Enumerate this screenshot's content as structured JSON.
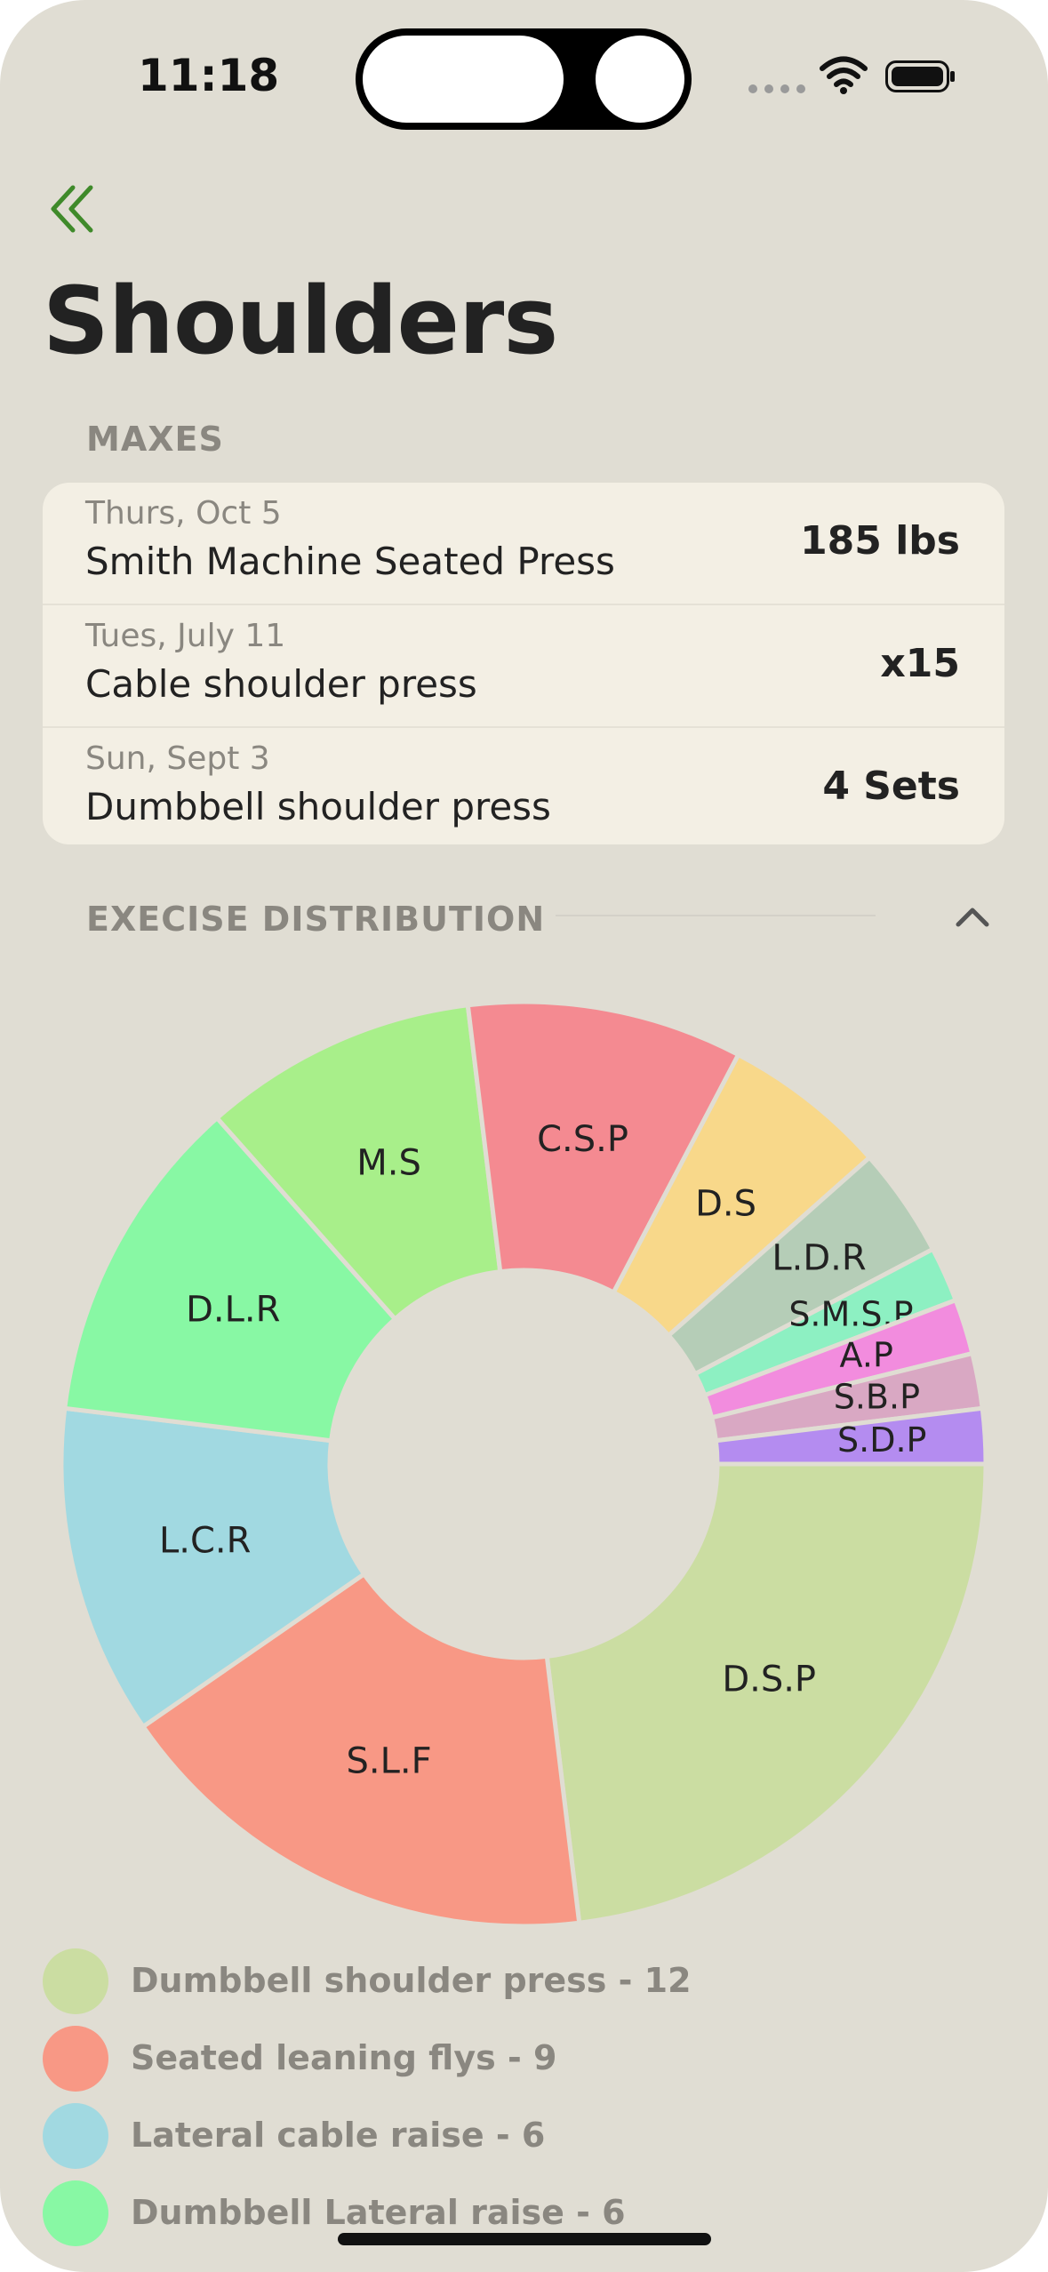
{
  "status_bar": {
    "time": "11:18"
  },
  "nav": {
    "back_icon": "double-chevron-left-icon",
    "accent": "#3f8a2a"
  },
  "page": {
    "title": "Shoulders"
  },
  "maxes": {
    "label": "MAXES",
    "rows": [
      {
        "date": "Thurs, Oct 5",
        "exercise": "Smith Machine Seated Press",
        "value": "185 lbs"
      },
      {
        "date": "Tues, July 11",
        "exercise": "Cable shoulder press",
        "value": "x15"
      },
      {
        "date": "Sun, Sept 3",
        "exercise": "Dumbbell shoulder press",
        "value": "4 Sets"
      }
    ]
  },
  "distribution": {
    "label": "EXECISE DISTRIBUTION",
    "collapse_icon": "chevron-up-icon",
    "legend": [
      {
        "text": "Dumbbell shoulder press - 12",
        "color": "#cbdda2"
      },
      {
        "text": "Seated leaning flys - 9",
        "color": "#f89885"
      },
      {
        "text": "Lateral cable raise - 6",
        "color": "#a1d9e1"
      },
      {
        "text": "Dumbbell Lateral raise - 6",
        "color": "#88f8a4"
      }
    ]
  },
  "chart_data": {
    "type": "pie",
    "title": "",
    "slices": [
      {
        "label": "D.S.P",
        "value": 12,
        "color": "#cbdda2"
      },
      {
        "label": "S.L.F",
        "value": 9,
        "color": "#f89885"
      },
      {
        "label": "L.C.R",
        "value": 6,
        "color": "#a1d9e1"
      },
      {
        "label": "D.L.R",
        "value": 6,
        "color": "#88f8a4"
      },
      {
        "label": "M.S",
        "value": 5,
        "color": "#a8ef8a"
      },
      {
        "label": "C.S.P",
        "value": 5,
        "color": "#f48a91"
      },
      {
        "label": "D.S",
        "value": 3,
        "color": "#f8d88a"
      },
      {
        "label": "L.D.R",
        "value": 2,
        "color": "#b5cdb7"
      },
      {
        "label": "S.M.S.P",
        "value": 1,
        "color": "#8df0c2"
      },
      {
        "label": "A.P",
        "value": 1,
        "color": "#f28cde"
      },
      {
        "label": "S.B.P",
        "value": 1,
        "color": "#d9a8c3"
      },
      {
        "label": "S.D.P",
        "value": 1,
        "color": "#b48cf0"
      }
    ]
  }
}
